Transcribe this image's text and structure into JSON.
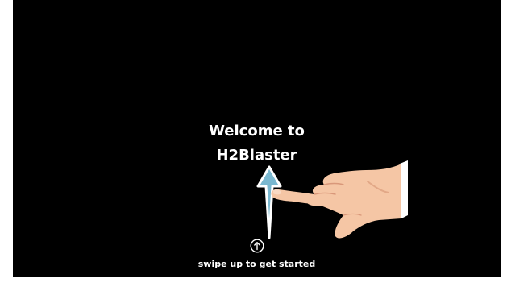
{
  "welcome": {
    "line1": "Welcome to",
    "line2": "H2Blaster"
  },
  "hint": {
    "text": "swipe up to get started"
  },
  "colors": {
    "background": "#000000",
    "text": "#ffffff",
    "arrow": "#7ab8d0",
    "skin": "#f5c6a5",
    "sleeve": "#ffffff"
  },
  "icons": {
    "swipe_arrow": "arrow-up-outline-icon",
    "hand": "pointing-hand-icon",
    "swipe_up": "arrow-up-circle-icon"
  }
}
